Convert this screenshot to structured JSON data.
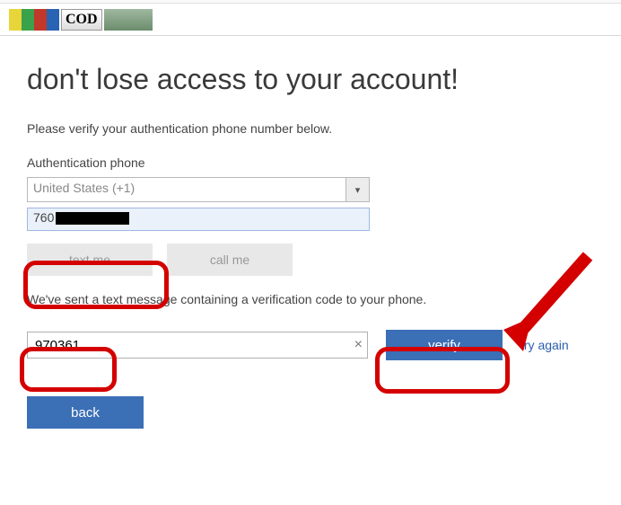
{
  "logo": {
    "text": "COD"
  },
  "heading": "don't lose access to your account!",
  "instruction": "Please verify your authentication phone number below.",
  "auth_phone_label": "Authentication phone",
  "country": {
    "selected": "United States (+1)"
  },
  "phone_prefix": "760",
  "buttons": {
    "text_me": "text me",
    "call_me": "call me",
    "verify": "verify",
    "back": "back"
  },
  "sent_message": "We've sent a text message containing a verification code to your phone.",
  "code_value": "970361",
  "try_again": "try again"
}
